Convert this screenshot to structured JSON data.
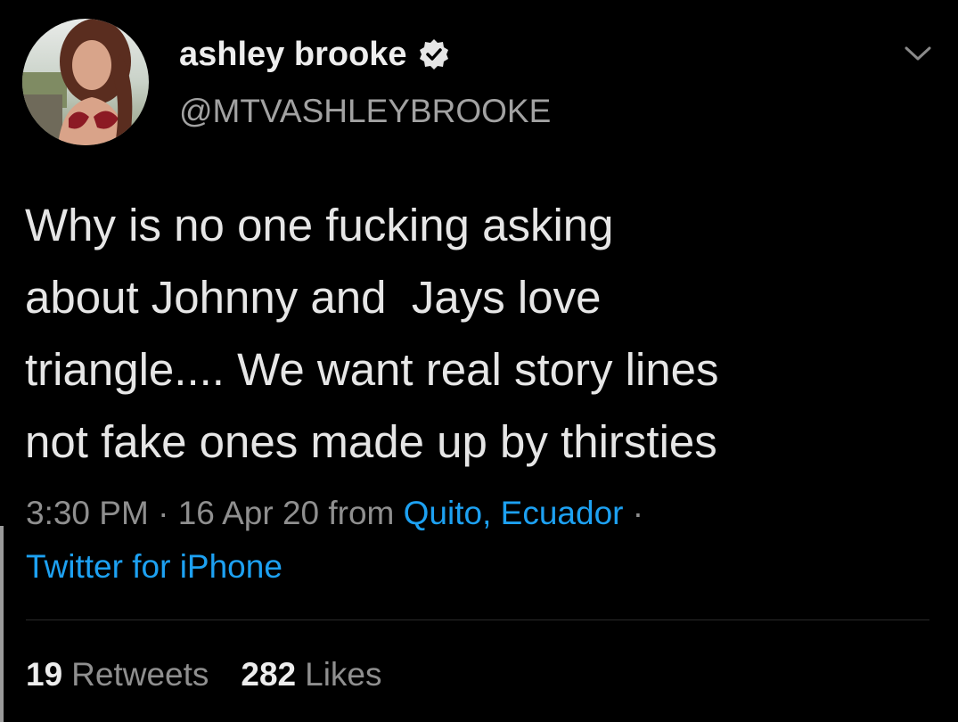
{
  "tweet": {
    "display_name": "ashley brooke",
    "handle": "@MTVASHLEYBROOKE",
    "text": "Why is no one fucking asking\nabout Johnny and  Jays love\ntriangle.... We want real story lines\nnot fake ones made up by thirsties",
    "time": "3:30 PM",
    "date": "16 Apr 20",
    "from_word": "from",
    "location": "Quito, Ecuador",
    "separator": "·",
    "source": "Twitter for iPhone",
    "retweets_count": "19",
    "retweets_label": "Retweets",
    "likes_count": "282",
    "likes_label": "Likes"
  },
  "icons": {
    "verified": "verified-badge-icon",
    "caret": "chevron-down-icon",
    "avatar": "profile-avatar"
  },
  "colors": {
    "background": "#000000",
    "link": "#1da1f2",
    "secondary_text": "#8f8f8f",
    "primary_text": "#e6e6e6"
  }
}
